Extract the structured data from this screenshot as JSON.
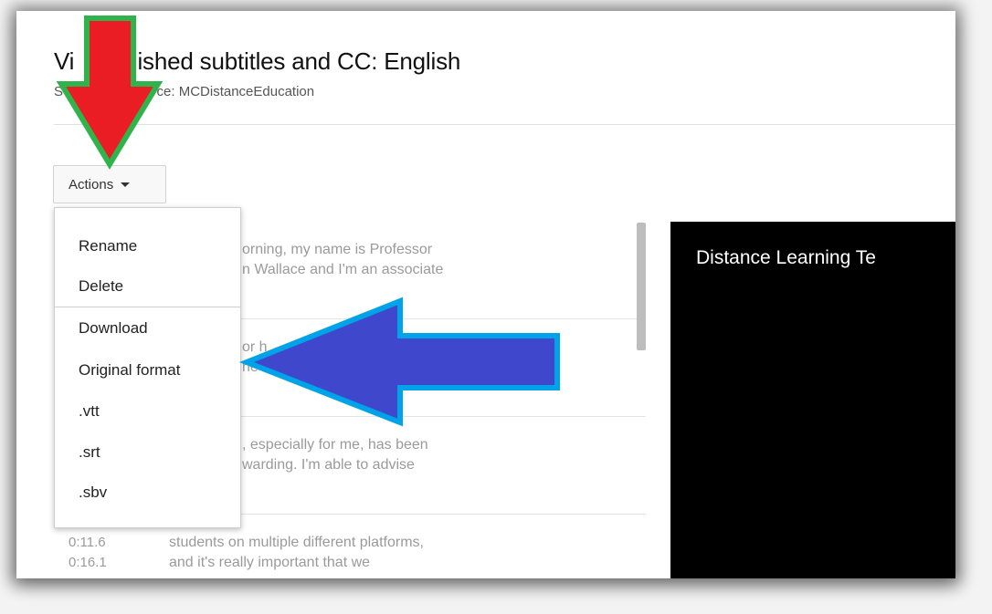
{
  "header": {
    "title": "Vi     ublished subtitles and CC: English",
    "subtitle": "S              C source: MCDistanceEducation"
  },
  "toolbar": {
    "actions_label": "Actions"
  },
  "actions_menu": {
    "items": [
      "Rename",
      "Delete"
    ],
    "download_header": "Download",
    "formats": [
      "Original format",
      ".vtt",
      ".srt",
      ".sbv"
    ]
  },
  "transcript": {
    "rows": [
      {
        "times": [
          "",
          ""
        ],
        "lines": [
          "orning, my name is Professor",
          "n Wallace and I'm an associate"
        ]
      },
      {
        "times": [
          "",
          ""
        ],
        "lines": [
          "or h",
          "ne"
        ]
      },
      {
        "times": [
          "",
          ""
        ],
        "lines": [
          ", especially for me, has been",
          "warding. I'm able to advise"
        ]
      },
      {
        "times": [
          "0:11.6",
          "0:16.1"
        ],
        "lines": [
          "students on multiple different platforms,",
          "and it's really important that we"
        ]
      }
    ]
  },
  "video": {
    "title": "Distance Learning Te"
  },
  "annotations": {
    "red_arrow_color": "#ea1c24",
    "red_arrow_outline": "#2fb34a",
    "blue_arrow_color": "#3f47cc",
    "blue_arrow_outline": "#00a2e8"
  }
}
